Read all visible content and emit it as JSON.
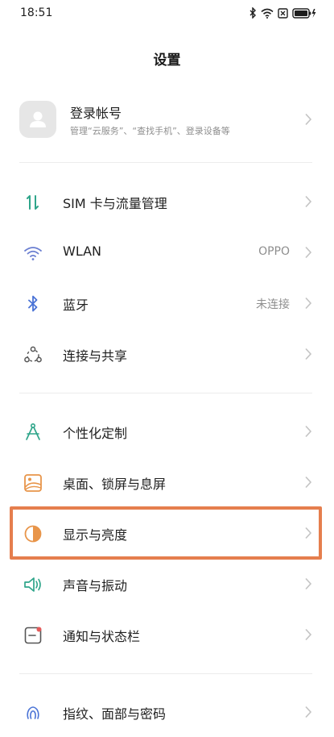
{
  "status_bar": {
    "time": "18:51",
    "icons": [
      "bluetooth-icon",
      "wifi-icon",
      "no-sim-icon",
      "battery-charging-icon"
    ]
  },
  "header": {
    "title": "设置"
  },
  "account": {
    "name": "登录帐号",
    "subtitle": "管理“云服务”、“查找手机”、登录设备等"
  },
  "sections": [
    {
      "items": [
        {
          "label": "SIM 卡与流量管理",
          "icon": "sim-data-icon"
        },
        {
          "label": "WLAN",
          "value": "OPPO",
          "icon": "wifi-icon"
        },
        {
          "label": "蓝牙",
          "value": "未连接",
          "icon": "bluetooth-icon"
        },
        {
          "label": "连接与共享",
          "icon": "connection-share-icon"
        }
      ]
    },
    {
      "items": [
        {
          "label": "个性化定制",
          "icon": "compass-icon"
        },
        {
          "label": "桌面、锁屏与息屏",
          "icon": "wallpaper-icon"
        },
        {
          "label": "显示与亮度",
          "icon": "brightness-icon",
          "highlighted": true
        },
        {
          "label": "声音与振动",
          "icon": "speaker-icon"
        },
        {
          "label": "通知与状态栏",
          "icon": "notification-icon"
        }
      ]
    },
    {
      "items": [
        {
          "label": "指纹、面部与密码",
          "icon": "fingerprint-icon"
        }
      ]
    }
  ],
  "colors": {
    "accent_teal": "#2fa58a",
    "highlight_border": "#e57e4e",
    "secondary_text": "#8e8e8e"
  }
}
